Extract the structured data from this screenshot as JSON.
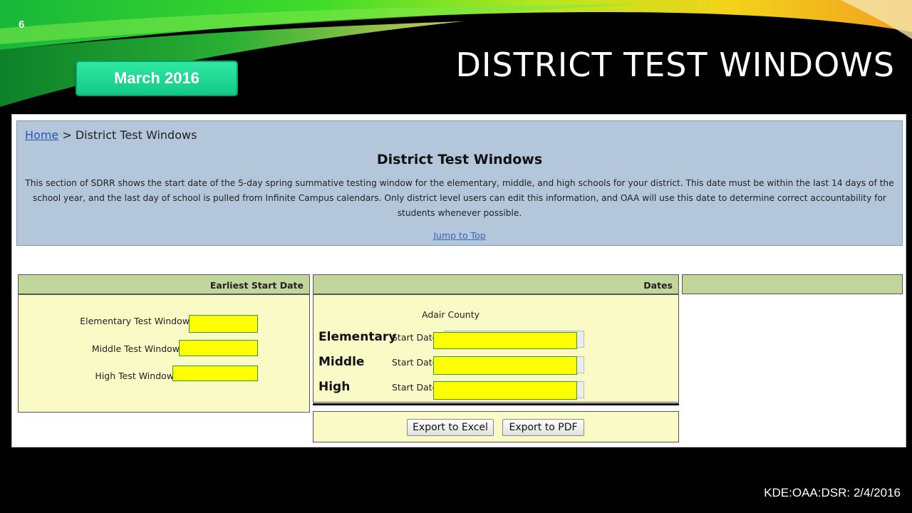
{
  "slide": {
    "number": "6",
    "badge": "March 2016",
    "title": "DISTRICT TEST WINDOWS",
    "footer": "KDE:OAA:DSR: 2/4/2016"
  },
  "screen": {
    "breadcrumb": {
      "home": "Home",
      "separator": " > ",
      "current": "District Test Windows"
    },
    "title": "District Test Windows",
    "description": "This section of SDRR shows the start date of the 5-day spring summative testing window for the elementary, middle, and high schools for your district. This date must be within the last 14 days of the school year, and the last day of school is pulled from Infinite Campus calendars. Only district level users can edit this information, and OAA will use this date to determine correct accountability for students whenever possible.",
    "jump_link": "Jump to Top",
    "earliest": {
      "header": "Earliest Start Date",
      "rows": [
        "Elementary Test Window",
        "Middle Test Window",
        "High Test Window"
      ]
    },
    "dates": {
      "header": "Dates",
      "district": "Adair County",
      "levels": [
        "Elementary",
        "Middle",
        "High"
      ],
      "start_label": "Start Date"
    },
    "buttons": {
      "excel": "Export to Excel",
      "pdf": "Export to PDF"
    }
  },
  "colors": {
    "highlight": "#ffff00",
    "panel_bg": "#fafac6",
    "header_bg": "#c2d59b",
    "info_bg": "#b4c6da",
    "badge": "#1fd891"
  }
}
